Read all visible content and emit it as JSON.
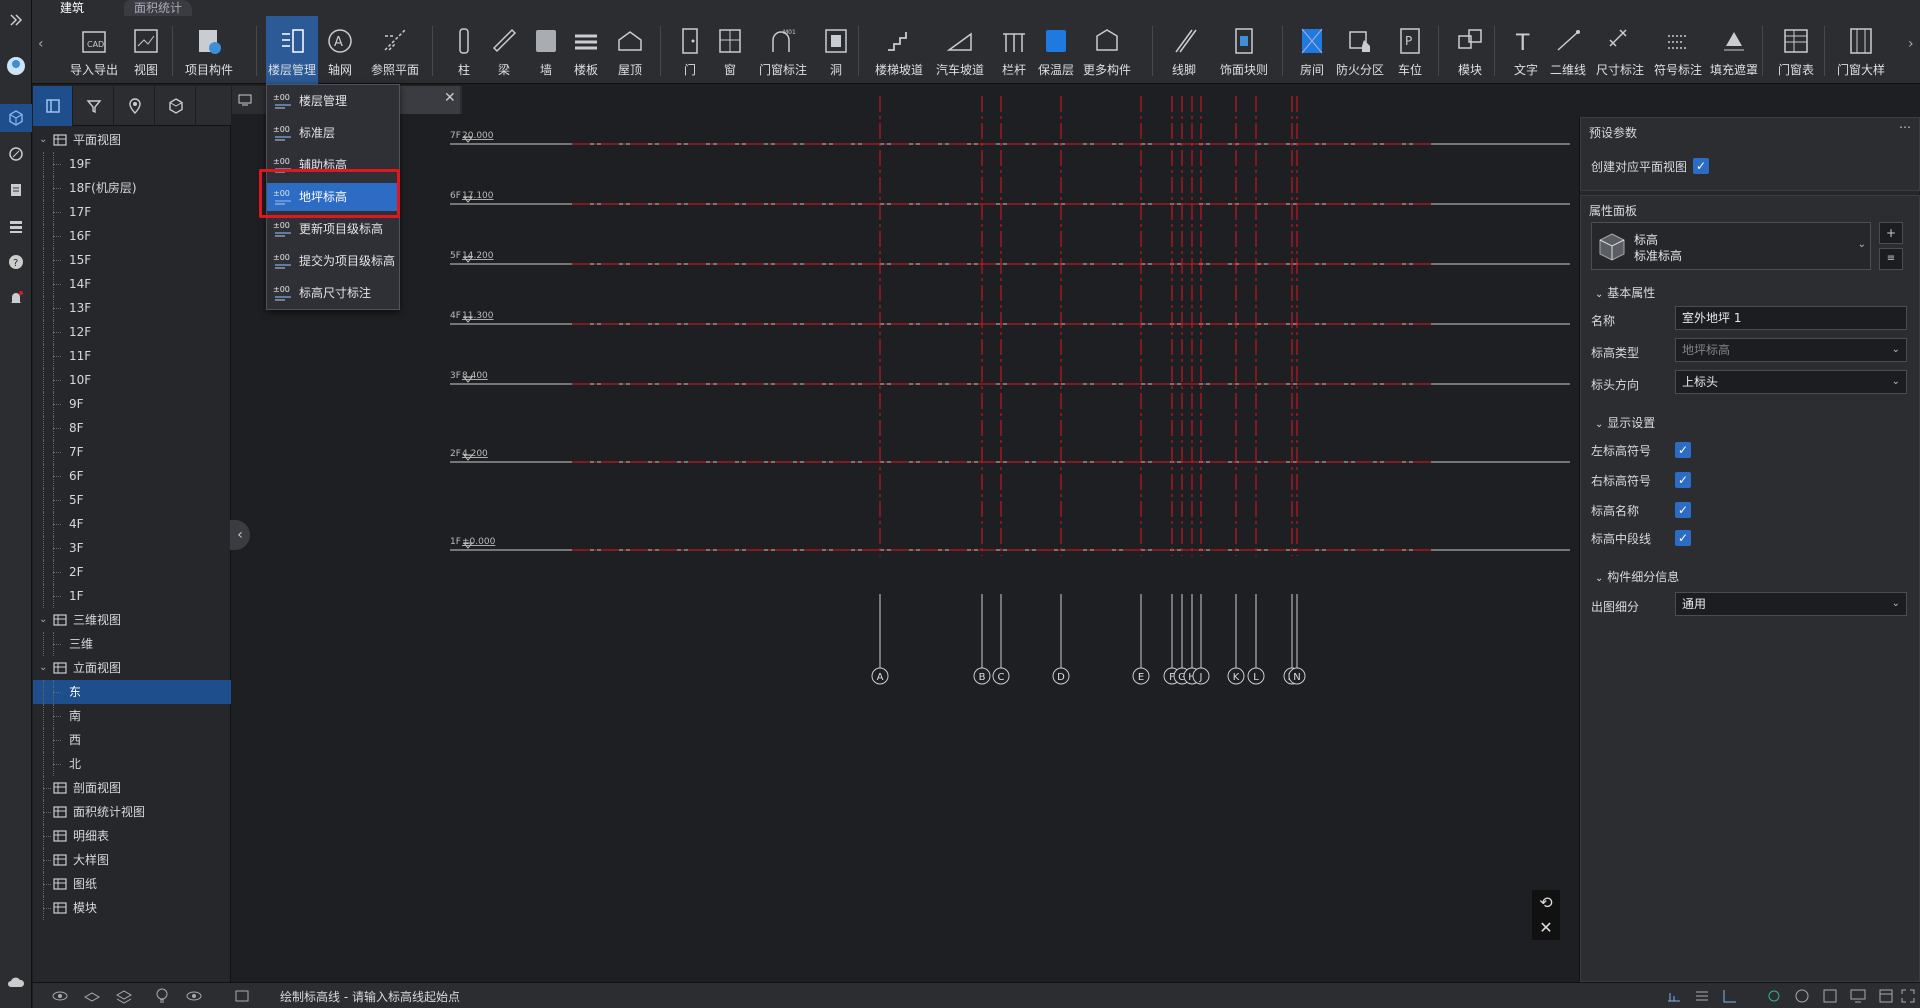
{
  "tabs": {
    "arch": "建筑",
    "area": "面积统计"
  },
  "ribbon": {
    "tools": [
      {
        "id": "import-export",
        "label": "导入导出",
        "icon": "cad-import-icon"
      },
      {
        "id": "view",
        "label": "视图",
        "icon": "view-icon"
      },
      {
        "id": "project-component",
        "label": "项目构件",
        "icon": "project-component-icon"
      },
      {
        "id": "floor-management",
        "label": "楼层管理",
        "icon": "floor-management-icon",
        "active": true
      },
      {
        "id": "axis-grid",
        "label": "轴网",
        "icon": "axis-grid-icon"
      },
      {
        "id": "reference-plane",
        "label": "参照平面",
        "icon": "reference-plane-icon"
      },
      {
        "id": "column",
        "label": "柱",
        "icon": "column-icon"
      },
      {
        "id": "beam",
        "label": "梁",
        "icon": "beam-icon"
      },
      {
        "id": "wall",
        "label": "墙",
        "icon": "wall-icon"
      },
      {
        "id": "slab",
        "label": "楼板",
        "icon": "slab-icon"
      },
      {
        "id": "roof",
        "label": "屋顶",
        "icon": "roof-icon"
      },
      {
        "id": "door",
        "label": "门",
        "icon": "door-icon"
      },
      {
        "id": "window",
        "label": "窗",
        "icon": "window-icon"
      },
      {
        "id": "door-window-tag",
        "label": "门窗标注",
        "icon": "door-window-tag-icon"
      },
      {
        "id": "opening",
        "label": "洞",
        "icon": "opening-icon"
      },
      {
        "id": "stair-ramp",
        "label": "楼梯坡道",
        "icon": "stair-ramp-icon"
      },
      {
        "id": "car-ramp",
        "label": "汽车坡道",
        "icon": "car-ramp-icon"
      },
      {
        "id": "railing",
        "label": "栏杆",
        "icon": "railing-icon"
      },
      {
        "id": "insulation",
        "label": "保温层",
        "icon": "insulation-icon"
      },
      {
        "id": "more-components",
        "label": "更多构件",
        "icon": "more-components-icon"
      },
      {
        "id": "skirting",
        "label": "线脚",
        "icon": "skirting-icon"
      },
      {
        "id": "finish-block",
        "label": "饰面块则",
        "icon": "finish-block-icon"
      },
      {
        "id": "room",
        "label": "房间",
        "icon": "room-icon"
      },
      {
        "id": "fire-zone",
        "label": "防火分区",
        "icon": "fire-zone-icon"
      },
      {
        "id": "parking",
        "label": "车位",
        "icon": "parking-icon"
      },
      {
        "id": "module",
        "label": "模块",
        "icon": "module-icon"
      },
      {
        "id": "text",
        "label": "文字",
        "icon": "text-icon"
      },
      {
        "id": "2d-line",
        "label": "二维线",
        "icon": "line-icon"
      },
      {
        "id": "dimension",
        "label": "尺寸标注",
        "icon": "dimension-icon"
      },
      {
        "id": "symbol",
        "label": "符号标注",
        "icon": "symbol-icon"
      },
      {
        "id": "fill-mask",
        "label": "填充遮罩",
        "icon": "fill-mask-icon"
      },
      {
        "id": "door-window-table",
        "label": "门窗表",
        "icon": "table-icon"
      },
      {
        "id": "door-window-detail",
        "label": "门窗大样",
        "icon": "detail-icon"
      }
    ]
  },
  "tree": {
    "nodes": [
      {
        "label": "平面视图",
        "level": 0,
        "icon": "plan-view-icon",
        "expandable": true
      },
      {
        "label": "19F",
        "level": 1
      },
      {
        "label": "18F(机房层)",
        "level": 1
      },
      {
        "label": "17F",
        "level": 1
      },
      {
        "label": "16F",
        "level": 1
      },
      {
        "label": "15F",
        "level": 1
      },
      {
        "label": "14F",
        "level": 1
      },
      {
        "label": "13F",
        "level": 1
      },
      {
        "label": "12F",
        "level": 1
      },
      {
        "label": "11F",
        "level": 1
      },
      {
        "label": "10F",
        "level": 1
      },
      {
        "label": "9F",
        "level": 1
      },
      {
        "label": "8F",
        "level": 1
      },
      {
        "label": "7F",
        "level": 1
      },
      {
        "label": "6F",
        "level": 1
      },
      {
        "label": "5F",
        "level": 1
      },
      {
        "label": "4F",
        "level": 1
      },
      {
        "label": "3F",
        "level": 1
      },
      {
        "label": "2F",
        "level": 1
      },
      {
        "label": "1F",
        "level": 1
      },
      {
        "label": "三维视图",
        "level": 0,
        "icon": "3d-view-icon",
        "expandable": true
      },
      {
        "label": "三维",
        "level": 1
      },
      {
        "label": "立面视图",
        "level": 0,
        "icon": "elevation-view-icon",
        "expandable": true
      },
      {
        "label": "东",
        "level": 1,
        "selected": true
      },
      {
        "label": "南",
        "level": 1
      },
      {
        "label": "西",
        "level": 1
      },
      {
        "label": "北",
        "level": 1
      },
      {
        "label": "剖面视图",
        "level": 0,
        "icon": "section-view-icon"
      },
      {
        "label": "面积统计视图",
        "level": 0,
        "icon": "area-view-icon"
      },
      {
        "label": "明细表",
        "level": 0,
        "icon": "schedule-icon"
      },
      {
        "label": "大样图",
        "level": 0,
        "icon": "detail-view-icon"
      },
      {
        "label": "图纸",
        "level": 0,
        "icon": "sheet-icon"
      },
      {
        "label": "模块",
        "level": 0,
        "icon": "module-tree-icon"
      }
    ]
  },
  "menu": {
    "items": [
      {
        "label": "楼层管理",
        "icon": "floor-manage-icon"
      },
      {
        "label": "标准层",
        "icon": "standard-floor-icon"
      },
      {
        "label": "辅助标高",
        "icon": "aux-level-icon"
      },
      {
        "label": "地坪标高",
        "icon": "ground-level-icon",
        "highlighted": true
      },
      {
        "label": "更新项目级标高",
        "icon": "update-level-icon"
      },
      {
        "label": "提交为项目级标高",
        "icon": "submit-level-icon"
      },
      {
        "label": "标高尺寸标注",
        "icon": "level-dimension-icon"
      }
    ]
  },
  "elevation": {
    "levels": [
      {
        "name": "7F",
        "value": "20.000"
      },
      {
        "name": "6F",
        "value": "17.100"
      },
      {
        "name": "5F",
        "value": "14.200"
      },
      {
        "name": "4F",
        "value": "11.300"
      },
      {
        "name": "3F",
        "value": "8.400"
      },
      {
        "name": "2F",
        "value": "4.200"
      },
      {
        "name": "1F",
        "value": "±0.000"
      }
    ],
    "axes": [
      "A",
      "B",
      "C",
      "D",
      "E",
      "F",
      "G",
      "H",
      "J",
      "K",
      "L",
      "M",
      "N"
    ],
    "colors": {
      "grid": "#e0171f",
      "level": "#cccccc",
      "background": "#1e1f22"
    }
  },
  "right_panel": {
    "preset_title": "预设参数",
    "preset_more": "⋯",
    "create_plan_label": "创建对应平面视图",
    "props_title": "属性面板",
    "type_name": "标高",
    "type_sub": "标准标高",
    "basic_group": "基本属性",
    "name_label": "名称",
    "name_value": "室外地坪 1",
    "level_type_label": "标高类型",
    "level_type_value": "地坪标高",
    "head_dir_label": "标头方向",
    "head_dir_value": "上标头",
    "display_group": "显示设置",
    "left_symbol_label": "左标高符号",
    "right_symbol_label": "右标高符号",
    "level_name_label": "标高名称",
    "mid_line_label": "标高中段线",
    "detail_group": "构件细分信息",
    "detail_label": "出图细分",
    "detail_value": "通用"
  },
  "status": {
    "message": "绘制标高线 - 请输入标高线起始点"
  }
}
